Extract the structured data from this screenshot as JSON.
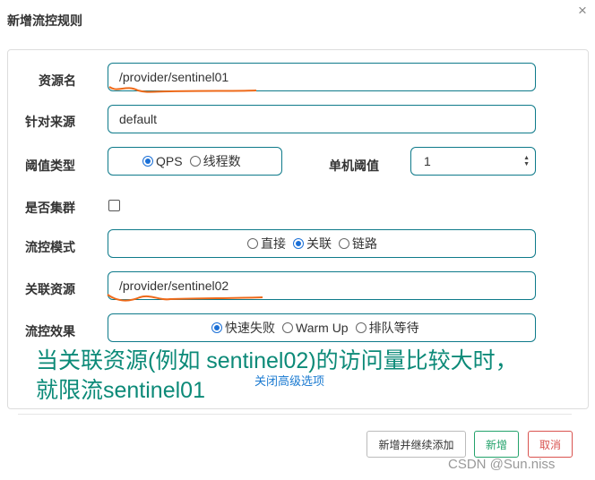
{
  "dialog": {
    "title": "新增流控规则",
    "close_glyph": "×"
  },
  "form": {
    "resource": {
      "label": "资源名",
      "value": "/provider/sentinel01"
    },
    "origin": {
      "label": "针对来源",
      "value": "default"
    },
    "threshold_type": {
      "label": "阈值类型",
      "options": [
        "QPS",
        "线程数"
      ],
      "selected": "QPS"
    },
    "single_threshold": {
      "label": "单机阈值",
      "value": "1"
    },
    "cluster": {
      "label": "是否集群",
      "checked": false
    },
    "flow_mode": {
      "label": "流控模式",
      "options": [
        "直接",
        "关联",
        "链路"
      ],
      "selected": "关联"
    },
    "ref_resource": {
      "label": "关联资源",
      "value": "/provider/sentinel02"
    },
    "effect": {
      "label": "流控效果",
      "options": [
        "快速失败",
        "Warm Up",
        "排队等待"
      ],
      "selected": "快速失败"
    }
  },
  "annotation": {
    "line1": "当关联资源(例如 sentinel02)的访问量比较大时，",
    "line2": "就限流sentinel01"
  },
  "advanced_link": "关闭高级选项",
  "buttons": {
    "add_continue": "新增并继续添加",
    "add": "新增",
    "cancel": "取消"
  },
  "watermark": "CSDN @Sun.niss",
  "colors": {
    "accent_border": "#0e7a8a",
    "radio_selected": "#1a6fd6",
    "add_button": "#23a26b",
    "cancel_button": "#d9534f",
    "annotation_text": "#0c8a78",
    "underline": "#ee6a1a"
  }
}
